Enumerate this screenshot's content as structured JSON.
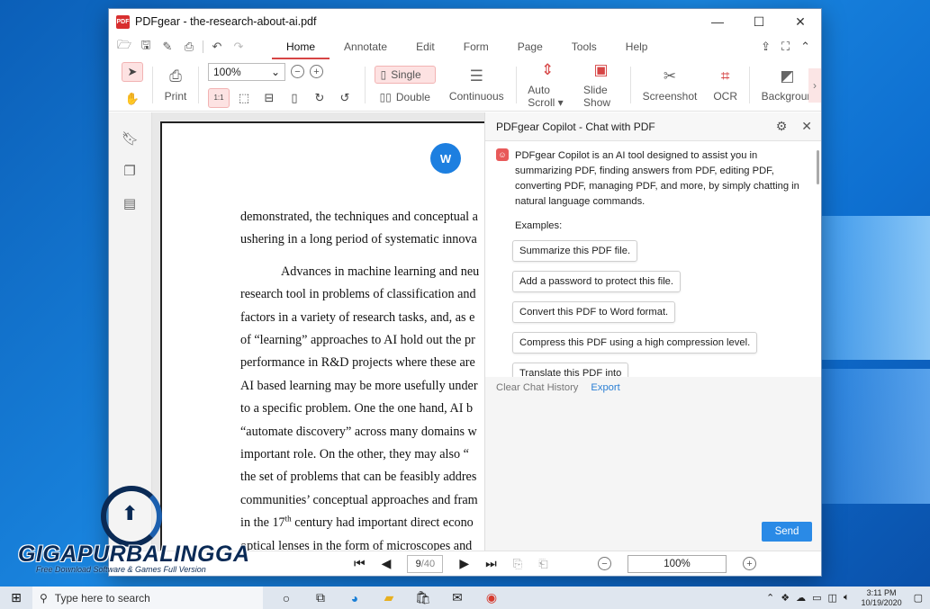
{
  "window": {
    "title": "PDFgear - the-research-about-ai.pdf",
    "logo_text": "PDF",
    "minimize": "—",
    "maximize": "☐",
    "close": "✕"
  },
  "menu": {
    "tabs": [
      "Home",
      "Annotate",
      "Edit",
      "Form",
      "Page",
      "Tools",
      "Help"
    ]
  },
  "toolbar": {
    "print": "Print",
    "zoom_value": "100%",
    "single": "Single",
    "double": "Double",
    "continuous": "Continuous",
    "auto_scroll": "Auto Scroll ▾",
    "slide_show": "Slide Show",
    "screenshot": "Screenshot",
    "ocr": "OCR",
    "background": "Backgroun"
  },
  "document": {
    "badge": "W",
    "lines": [
      "demonstrated, the techniques and conceptual a",
      "ushering in a long period of systematic innova"
    ],
    "para_first": "Advances in machine learning and neu",
    "para_lines": [
      "research tool in problems of classification and",
      "factors in a variety of research tasks, and, as e",
      "of “learning” approaches to AI hold out the pr",
      "performance in R&D projects where these are",
      "AI based learning may be more usefully under",
      "to a specific problem.  One the one hand, AI b",
      "“automate discovery” across many domains w",
      "important role.  On the other, they may also “",
      "the set of problems that can be feasibly addres",
      "communities’ conceptual approaches and fram"
    ],
    "century_pre": "in the 17",
    "century_sup": "th",
    "century_post": " century had important direct econo",
    "last_line": "optical lenses in the form of microscopes and"
  },
  "copilot": {
    "title": "PDFgear Copilot - Chat with PDF",
    "intro": "PDFgear Copilot is an AI tool designed to assist you in summarizing PDF, finding answers from PDF, editing PDF, converting PDF, managing PDF, and more, by simply chatting in natural language commands.",
    "examples_label": "Examples:",
    "examples": [
      "Summarize this PDF file.",
      "Add a password to protect this file.",
      "Convert this PDF to Word format.",
      "Compress this PDF using a high compression level.",
      "Translate this PDF into"
    ],
    "clear_history": "Clear Chat History",
    "export": "Export",
    "send": "Send"
  },
  "status": {
    "current_page": "9",
    "total_pages": "/40",
    "zoom": "100%"
  },
  "watermark": {
    "name": "GIGAPURBALINGGA",
    "tagline": "Free Download Software & Games Full Version"
  },
  "taskbar": {
    "search_placeholder": "Type here to search",
    "time": "3:11 PM",
    "date": "10/19/2020"
  }
}
